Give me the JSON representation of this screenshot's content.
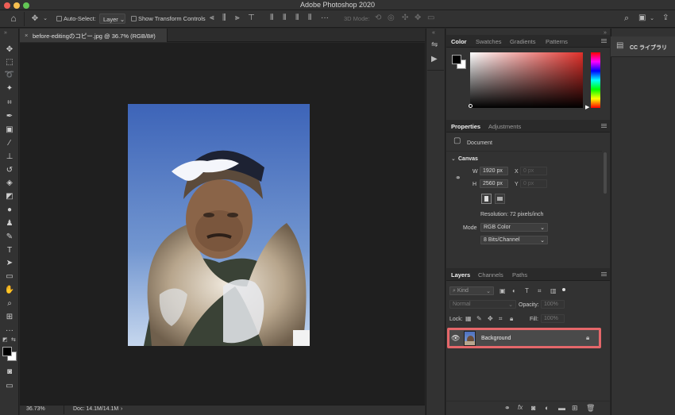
{
  "window": {
    "title": "Adobe Photoshop 2020"
  },
  "options_bar": {
    "auto_select_label": "Auto-Select:",
    "auto_select_value": "Layer",
    "show_transform_label": "Show Transform Controls",
    "mode_3d_label": "3D Mode:"
  },
  "document": {
    "tab_label": "before-editingのコピー.jpg @ 36.7% (RGB/8#)",
    "close_glyph": "×",
    "zoom": "36.73%",
    "doc_size": "Doc: 14.1M/14.1M"
  },
  "color_panel": {
    "tabs": [
      "Color",
      "Swatches",
      "Gradients",
      "Patterns"
    ],
    "active_tab": 0
  },
  "properties_panel": {
    "tabs": [
      "Properties",
      "Adjustments"
    ],
    "type_label": "Document",
    "section": "Canvas",
    "width_label": "W",
    "width_value": "1920 px",
    "height_label": "H",
    "height_value": "2560 px",
    "x_label": "X",
    "x_placeholder": "0 px",
    "y_label": "Y",
    "y_placeholder": "0 px",
    "resolution": "Resolution: 72 pixels/inch",
    "mode_label": "Mode",
    "mode_value": "RGB Color",
    "depth_value": "8 Bits/Channel"
  },
  "layers_panel": {
    "tabs": [
      "Layers",
      "Channels",
      "Paths"
    ],
    "filter_label": "Kind",
    "blend_mode": "Normal",
    "opacity_label": "Opacity:",
    "opacity_value": "100%",
    "lock_label": "Lock:",
    "fill_label": "Fill:",
    "fill_value": "100%",
    "layer_name": "Background",
    "bottom_icons": [
      "link-icon",
      "fx-icon",
      "mask-icon",
      "adjustment-icon",
      "folder-icon",
      "new-layer-icon",
      "trash-icon"
    ],
    "footer_fx": "fx"
  },
  "cc_panel": {
    "title": "CC ライブラリ"
  },
  "colors": {
    "accent_highlight": "#e5676a",
    "close": "#ee5e56",
    "minimize": "#f5bf4f",
    "maximize": "#62c655"
  }
}
